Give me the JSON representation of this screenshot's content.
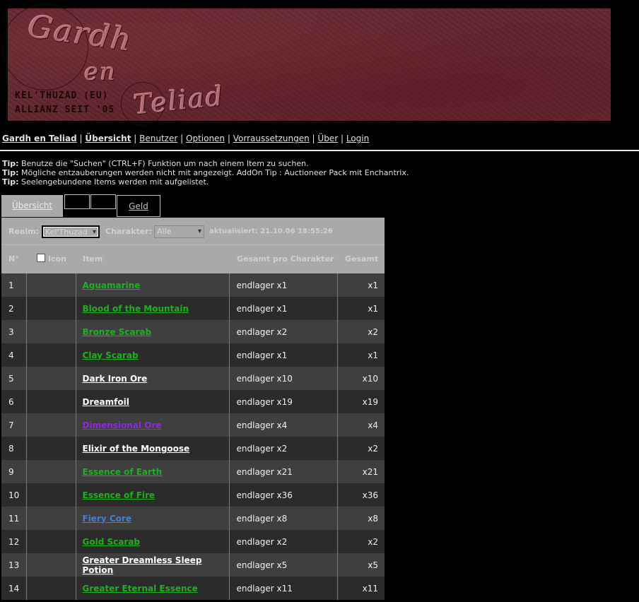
{
  "banner": {
    "script_line1": "Gardh",
    "script_line2": "en",
    "script_line3": "Teliad",
    "sub_line1": "KEL'THUZAD (EU)",
    "sub_line2": "ALLIANZ SEIT '05"
  },
  "nav": {
    "home": "Gardh en Teliad",
    "overview": "Übersicht",
    "users": "Benutzer",
    "options": "Optionen",
    "requirements": "Vorraussetzungen",
    "about": "Über",
    "login": "Login",
    "separator": "|"
  },
  "tips": [
    {
      "label": "Tip:",
      "text": "Benutze die \"Suchen\" (CTRL+F) Funktion um nach einem Item zu suchen."
    },
    {
      "label": "Tip:",
      "text": "Mögliche entzauberungen werden nicht mit angezeigt. AddOn Tip : Auctioneer Pack mit Enchantrix."
    },
    {
      "label": "Tip:",
      "text": "Seelengebundene Items werden mit aufgelistet."
    }
  ],
  "tabs": {
    "overview": "Übersicht",
    "money": "Geld"
  },
  "filter": {
    "realm_label": "Realm:",
    "realm_value": "Kel'Thuzad",
    "char_label": "Charakter:",
    "char_value": "Alle",
    "updated": "aktualisiert: 21.10.06 18:55:26"
  },
  "table": {
    "headers": {
      "no": "N°",
      "icon": "Icon",
      "item": "Item",
      "per_char": "Gesamt pro Charakter",
      "total": "Gesamt"
    },
    "rows": [
      {
        "no": "1",
        "item": "Aguamarine",
        "color": "#1eb01e",
        "per_char": "endlager x1",
        "total": "x1"
      },
      {
        "no": "2",
        "item": "Blood of the Mountain",
        "color": "#1eb01e",
        "per_char": "endlager x1",
        "total": "x1"
      },
      {
        "no": "3",
        "item": "Bronze Scarab",
        "color": "#1eb01e",
        "per_char": "endlager x2",
        "total": "x2"
      },
      {
        "no": "4",
        "item": "Clay Scarab",
        "color": "#1eb01e",
        "per_char": "endlager x1",
        "total": "x1"
      },
      {
        "no": "5",
        "item": "Dark Iron Ore",
        "color": "#ffffff",
        "per_char": "endlager x10",
        "total": "x10"
      },
      {
        "no": "6",
        "item": "Dreamfoil",
        "color": "#ffffff",
        "per_char": "endlager x19",
        "total": "x19"
      },
      {
        "no": "7",
        "item": "Dimensional Ore",
        "color": "#8a2be2",
        "per_char": "endlager x4",
        "total": "x4"
      },
      {
        "no": "8",
        "item": "Elixir of the Mongoose",
        "color": "#ffffff",
        "per_char": "endlager x2",
        "total": "x2"
      },
      {
        "no": "9",
        "item": "Essence of Earth",
        "color": "#1eb01e",
        "per_char": "endlager x21",
        "total": "x21"
      },
      {
        "no": "10",
        "item": "Essence of Fire",
        "color": "#1eb01e",
        "per_char": "endlager x36",
        "total": "x36"
      },
      {
        "no": "11",
        "item": "Fiery Core",
        "color": "#3f7fe0",
        "per_char": "endlager x8",
        "total": "x8"
      },
      {
        "no": "12",
        "item": "Gold Scarab",
        "color": "#1eb01e",
        "per_char": "endlager x2",
        "total": "x2"
      },
      {
        "no": "13",
        "item": "Greater Dreamless Sleep Potion",
        "color": "#ffffff",
        "per_char": "endlager x5",
        "total": "x5"
      },
      {
        "no": "14",
        "item": "Greater Eternal Essence",
        "color": "#1eb01e",
        "per_char": "endlager x11",
        "total": "x11"
      }
    ]
  }
}
